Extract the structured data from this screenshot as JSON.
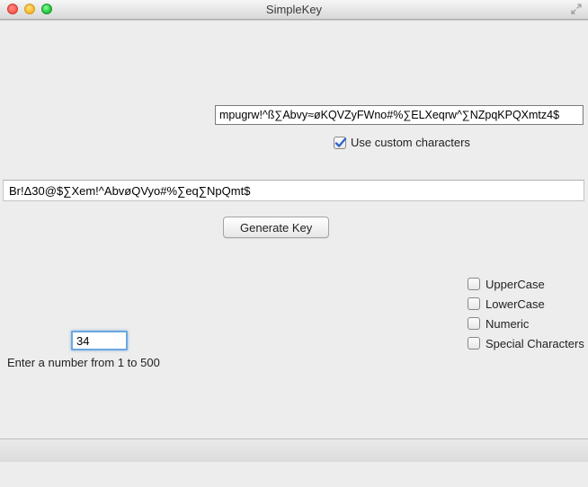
{
  "window": {
    "title": "SimpleKey"
  },
  "inputs": {
    "customChars": "mpugrw!^ß∑Abvy≈øKQVZyFWno#%∑ELXeqrw^∑NZpqKPQXmtz4$",
    "useCustomLabel": "Use custom characters",
    "useCustomChecked": true,
    "output": "Br!Δ30@$∑Xem!^AbvøQVyo#%∑eq∑NpQmt$",
    "generateLabel": "Generate Key",
    "length": "34",
    "lengthHint": "Enter a number from 1 to 500"
  },
  "charOptions": [
    {
      "key": "uppercase",
      "label": "UpperCase",
      "checked": false
    },
    {
      "key": "lowercase",
      "label": "LowerCase",
      "checked": false
    },
    {
      "key": "numeric",
      "label": "Numeric",
      "checked": false
    },
    {
      "key": "special",
      "label": "Special Characters",
      "checked": false
    }
  ]
}
